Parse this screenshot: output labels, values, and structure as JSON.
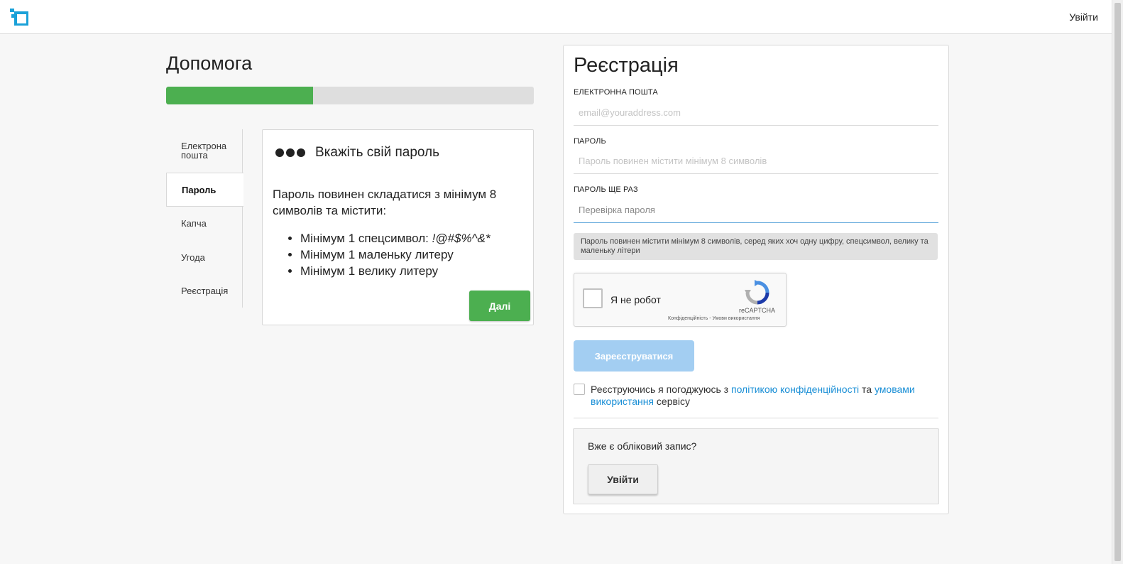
{
  "header": {
    "logo_icon": "site-logo-icon",
    "login_link": "Увійти",
    "accent_color": "#1aa1d8"
  },
  "help": {
    "title": "Допомога",
    "progress_fraction": 0.4,
    "progress_color": "#4caf50",
    "steps": [
      {
        "label": "Електрона пошта",
        "active": false
      },
      {
        "label": "Пароль",
        "active": true
      },
      {
        "label": "Капча",
        "active": false
      },
      {
        "label": "Угода",
        "active": false
      },
      {
        "label": "Реєстрація",
        "active": false
      }
    ],
    "card": {
      "icon": "password-dots-icon",
      "title": "Вкажіть свій пароль",
      "intro": "Пароль повинен складатися з мінімум 8 символів та містити:",
      "requirements": [
        {
          "text": "Мінімум 1 спецсимвол: ",
          "hint": "!@#$%^&*"
        },
        {
          "text": "Мінімум 1 маленьку литеру",
          "hint": ""
        },
        {
          "text": "Мінімум 1 велику литеру",
          "hint": ""
        }
      ],
      "next_button": "Далі"
    }
  },
  "registration": {
    "title": "Реєстрація",
    "email": {
      "label": "ЕЛЕКТРОННА ПОШТА",
      "placeholder": "email@youraddress.com",
      "value": ""
    },
    "password": {
      "label": "ПАРОЛЬ",
      "placeholder": "Пароль повинен містити мінімум 8 символів",
      "value": ""
    },
    "password_repeat": {
      "label": "ПАРОЛЬ ЩЕ РАЗ",
      "placeholder": "Перевірка пароля",
      "value": ""
    },
    "password_hint": "Пароль повинен містити мінімум 8 символів, серед яких хоч одну цифру, спецсимвол, велику та маленьку літери",
    "captcha": {
      "label": "Я не робот",
      "brand": "reCAPTCHA",
      "legal": "Конфіденційність - Умови використання",
      "icon": "recaptcha-icon"
    },
    "register_button": "Зареєструватися",
    "register_button_color": "#a3cef2",
    "agreement": {
      "prefix": "Реєструючись я погоджуюсь з ",
      "privacy_link": "політикою конфіденційності",
      "middle": " та ",
      "terms_link": "умовами використання",
      "suffix": " сервісу",
      "link_color": "#1a8fd6"
    },
    "existing_account": {
      "question": "Вже є обліковий запис?",
      "login_button": "Увійти"
    }
  }
}
